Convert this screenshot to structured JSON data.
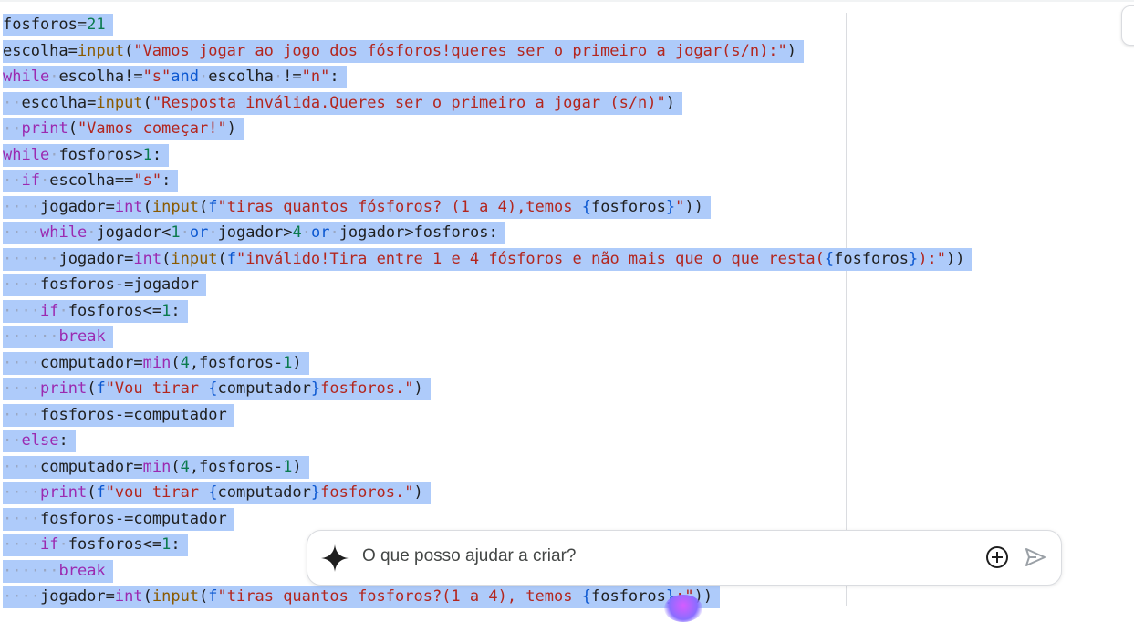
{
  "code_lines": [
    "fosforos=21",
    "escolha=input(\"Vamos jogar ao jogo dos fósforos!queres ser o primeiro a jogar(s/n):\")",
    "while escolha!=\"s\"and escolha !=\"n\":",
    "  escolha=input(\"Resposta inválida.Queres ser o primeiro a jogar (s/n)\")",
    "  print(\"Vamos começar!\")",
    "while fosforos>1:",
    "  if escolha==\"s\":",
    "    jogador=int(input(f\"tiras quantos fósforos? (1 a 4),temos {fosforos}\"))",
    "    while jogador<1 or jogador>4 or jogador>fosforos:",
    "      jogador=int(input(f\"inválido!Tira entre 1 e 4 fósforos e não mais que o que resta({fosforos}):\"))",
    "    fosforos-=jogador",
    "    if fosforos<=1:",
    "      break",
    "    computador=min(4,fosforos-1)",
    "    print(f\"Vou tirar {computador}fosforos.\")",
    "    fosforos-=computador",
    "  else:",
    "    computador=min(4,fosforos-1)",
    "    print(f\"vou tirar {computador}fosforos.\")",
    "    fosforos-=computador",
    "    if fosforos<=1:",
    "      break",
    "    jogador=int(input(f\"tiras quantos fosforos?(1 a 4), temos {fosforos}:\"))"
  ],
  "prompt": {
    "placeholder": "O que posso ajudar a criar?",
    "icons": [
      "sparkle-icon",
      "add-icon",
      "send-icon"
    ]
  },
  "colors": {
    "selection": "#aecbfa",
    "keyword": "#9b2ab0",
    "string": "#b3261e",
    "number": "#0b7a4e"
  }
}
